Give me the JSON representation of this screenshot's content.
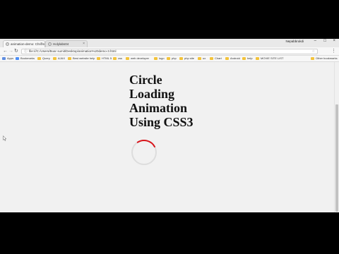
{
  "browser": {
    "tabs": [
      {
        "title": "animation-demo: Chrom"
      },
      {
        "title": "Holylabs04"
      }
    ],
    "profile_name": "Nepabbrukdi",
    "address": {
      "url": "file:///C:/Users/Boar sumit/Desktop/animation%20demo-3.html"
    },
    "bookmarks": [
      {
        "label": "Apps",
        "icon": "apps-icon"
      },
      {
        "label": "Bookmarks",
        "icon": "star-icon"
      },
      {
        "label": "Query",
        "icon": "folder-icon"
      },
      {
        "label": "AJAX",
        "icon": "folder-icon"
      },
      {
        "label": "Best website help",
        "icon": "folder-icon"
      },
      {
        "label": "HTML 5",
        "icon": "folder-icon"
      },
      {
        "label": "css",
        "icon": "folder-icon"
      },
      {
        "label": "web developer",
        "icon": "folder-icon"
      },
      {
        "label": "logo",
        "icon": "folder-icon"
      },
      {
        "label": "php",
        "icon": "folder-icon"
      },
      {
        "label": "php site",
        "icon": "folder-icon"
      },
      {
        "label": "ux",
        "icon": "folder-icon"
      },
      {
        "label": "Chart",
        "icon": "folder-icon"
      },
      {
        "label": "Android",
        "icon": "folder-icon"
      },
      {
        "label": "help",
        "icon": "folder-icon"
      },
      {
        "label": "MOVIE SITE LIST",
        "icon": "folder-icon"
      },
      {
        "label": "Other bookmarks",
        "icon": "folder-icon"
      }
    ]
  },
  "page": {
    "heading_lines": [
      "Circle",
      "Loading",
      "Animation",
      "Using CSS3"
    ]
  },
  "colors": {
    "spinner_track": "#dddddd",
    "spinner_arc": "#d9151b"
  }
}
